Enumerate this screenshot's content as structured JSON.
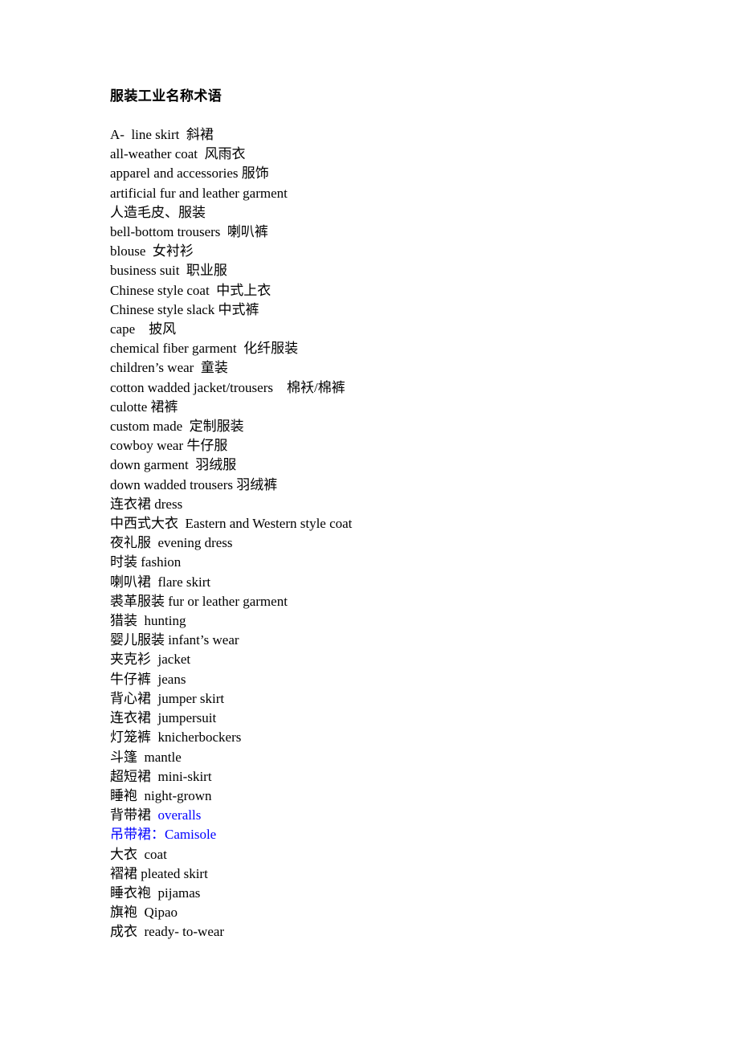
{
  "document": {
    "title": "服装工业名称术语",
    "background_color": "#ffffff",
    "text_color": "#000000",
    "accent_color": "#0000ff",
    "blank_line_after_title": " "
  },
  "terms": [
    {
      "text": "A-  line skirt  斜裙",
      "color": "black"
    },
    {
      "text": "all-weather coat  风雨衣",
      "color": "black"
    },
    {
      "text": "apparel and accessories 服饰",
      "color": "black"
    },
    {
      "text": "artificial fur and leather garment",
      "color": "black"
    },
    {
      "text": "人造毛皮、服装",
      "color": "black"
    },
    {
      "text": "bell-bottom trousers  喇叭裤",
      "color": "black"
    },
    {
      "text": "blouse  女衬衫",
      "color": "black"
    },
    {
      "text": "business suit  职业服",
      "color": "black"
    },
    {
      "text": "Chinese style coat  中式上衣",
      "color": "black"
    },
    {
      "text": "Chinese style slack 中式裤",
      "color": "black"
    },
    {
      "text": "cape    披风",
      "color": "black"
    },
    {
      "text": "chemical fiber garment  化纤服装",
      "color": "black"
    },
    {
      "text": "children’s wear  童装",
      "color": "black"
    },
    {
      "text": "cotton wadded jacket/trousers    棉袄/棉裤",
      "color": "black"
    },
    {
      "text": "culotte 裙裤",
      "color": "black"
    },
    {
      "text": "custom made  定制服装",
      "color": "black"
    },
    {
      "text": "cowboy wear 牛仔服",
      "color": "black"
    },
    {
      "text": "down garment  羽绒服",
      "color": "black"
    },
    {
      "text": "down wadded trousers 羽绒裤",
      "color": "black"
    },
    {
      "text": "连衣裙 dress",
      "color": "black"
    },
    {
      "text": "中西式大衣  Eastern and Western style coat",
      "color": "black"
    },
    {
      "text": "夜礼服  evening dress",
      "color": "black"
    },
    {
      "text": "时装 fashion",
      "color": "black"
    },
    {
      "text": "喇叭裙  flare skirt",
      "color": "black"
    },
    {
      "text": "裘革服装 fur or leather garment",
      "color": "black"
    },
    {
      "text": "猎装  hunting",
      "color": "black"
    },
    {
      "text": "婴儿服装 infant’s wear",
      "color": "black"
    },
    {
      "text": "夹克衫  jacket",
      "color": "black"
    },
    {
      "text": "牛仔裤  jeans",
      "color": "black"
    },
    {
      "text": "背心裙  jumper skirt",
      "color": "black"
    },
    {
      "text": "连衣裙  jumpersuit",
      "color": "black"
    },
    {
      "text": "灯笼裤  knicherbockers",
      "color": "black"
    },
    {
      "text": "斗篷  mantle",
      "color": "black"
    },
    {
      "text": "超短裙  mini-skirt",
      "color": "black"
    },
    {
      "text": "睡袍  night-grown",
      "color": "black"
    },
    {
      "text": "背带裙  ",
      "color": "black",
      "suffix": "overalls",
      "suffix_color": "blue"
    },
    {
      "text": "吊带裙：Camisole",
      "color": "blue"
    },
    {
      "text": "大衣  coat",
      "color": "black"
    },
    {
      "text": "褶裙 pleated skirt",
      "color": "black"
    },
    {
      "text": "睡衣袍  pijamas",
      "color": "black"
    },
    {
      "text": "旗袍  Qipao",
      "color": "black"
    },
    {
      "text": "成衣  ready- to-wear",
      "color": "black"
    }
  ]
}
